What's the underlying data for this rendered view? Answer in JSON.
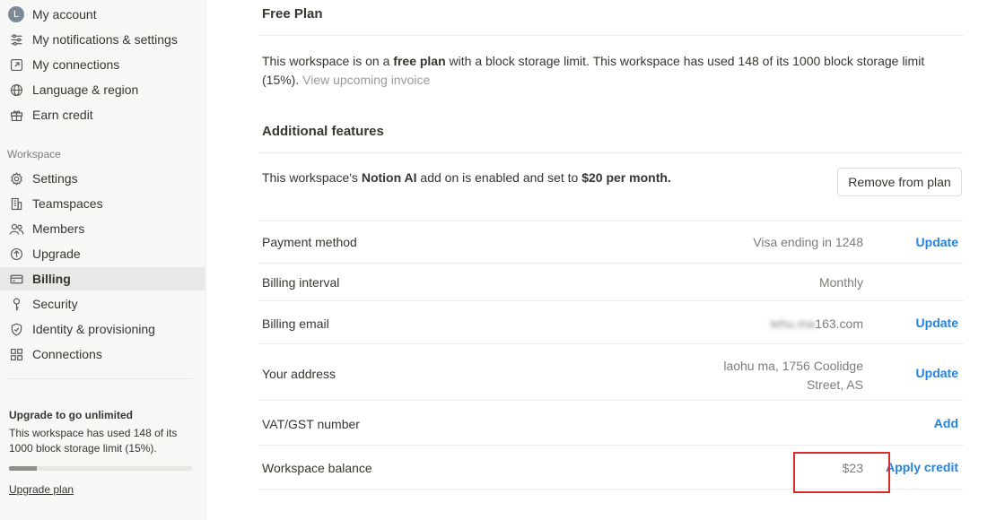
{
  "sidebar": {
    "account": {
      "avatar_letter": "L",
      "label": "My account"
    },
    "notifications": "My notifications & settings",
    "connections_personal": "My connections",
    "language": "Language & region",
    "earn": "Earn credit",
    "section_label": "Workspace",
    "settings": "Settings",
    "teamspaces": "Teamspaces",
    "members": "Members",
    "upgrade": "Upgrade",
    "billing": "Billing",
    "security": "Security",
    "identity": "Identity & provisioning",
    "connections": "Connections",
    "upgrade_box": {
      "title": "Upgrade to go unlimited",
      "desc": "This workspace has used 148 of its 1000 block storage limit (15%).",
      "progress_fraction": 0.15,
      "link": "Upgrade plan"
    }
  },
  "main": {
    "plan_title": "Free Plan",
    "plan_desc": {
      "pre": "This workspace is on a ",
      "bold": "free plan",
      "post": " with a block storage limit. This workspace has used 148 of its 1000 block storage limit (15%).",
      "link": "View upcoming invoice"
    },
    "features_title": "Additional features",
    "features_text": {
      "pre": "This workspace's ",
      "bold1": "Notion AI",
      "mid": " add on is enabled and set to ",
      "bold2": "$20 per month."
    },
    "remove_button": "Remove from plan",
    "rows": {
      "payment": {
        "label": "Payment method",
        "value": "Visa ending in 1248",
        "action": "Update"
      },
      "interval": {
        "label": "Billing interval",
        "value": "Monthly"
      },
      "email": {
        "label": "Billing email",
        "value_hidden": "lehu.ma",
        "value_visible": "163.com",
        "action": "Update"
      },
      "address": {
        "label": "Your address",
        "value_line1": "laohu ma, 1756 Coolidge",
        "value_line2": "Street, AS",
        "action": "Update"
      },
      "vat": {
        "label": "VAT/GST number",
        "action": "Add"
      },
      "balance": {
        "label": "Workspace balance",
        "value": "$23",
        "action": "Apply credit"
      }
    }
  },
  "colors": {
    "accent": "#2383e2",
    "highlight": "#d92c2c",
    "sidebar_bg": "#f7f7f5"
  }
}
